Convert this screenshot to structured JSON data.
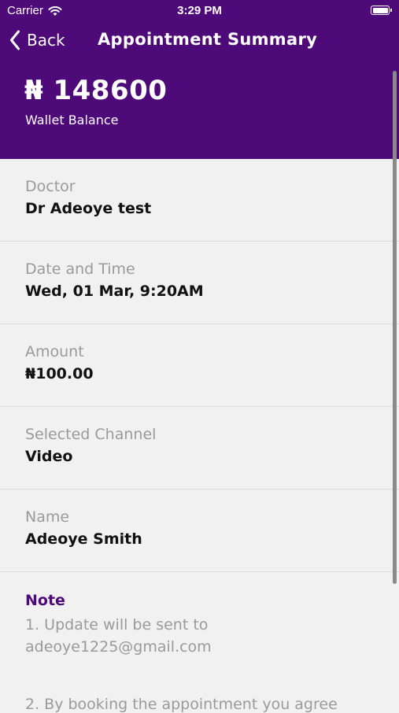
{
  "status_bar": {
    "carrier": "Carrier",
    "time": "3:29 PM"
  },
  "nav": {
    "back_label": "Back",
    "title": "Appointment Summary"
  },
  "wallet": {
    "balance": "₦ 148600",
    "label": "Wallet Balance"
  },
  "summary": [
    {
      "label": "Doctor",
      "value": "Dr Adeoye test"
    },
    {
      "label": "Date and Time",
      "value": "Wed, 01 Mar, 9:20AM"
    },
    {
      "label": "Amount",
      "value": "₦100.00"
    },
    {
      "label": "Selected Channel",
      "value": "Video"
    },
    {
      "label": "Name",
      "value": "Adeoye Smith"
    }
  ],
  "note": {
    "title": "Note",
    "line1": "1. Update will be sent to",
    "line2": "adeoye1225@gmail.com",
    "line3": "2. By booking the appointment you agree"
  },
  "colors": {
    "brand": "#4f0a79",
    "background": "#f1f1f1",
    "muted_text": "#9a9a9a"
  },
  "icons": [
    "wifi-icon",
    "battery-icon",
    "chevron-back-icon"
  ]
}
